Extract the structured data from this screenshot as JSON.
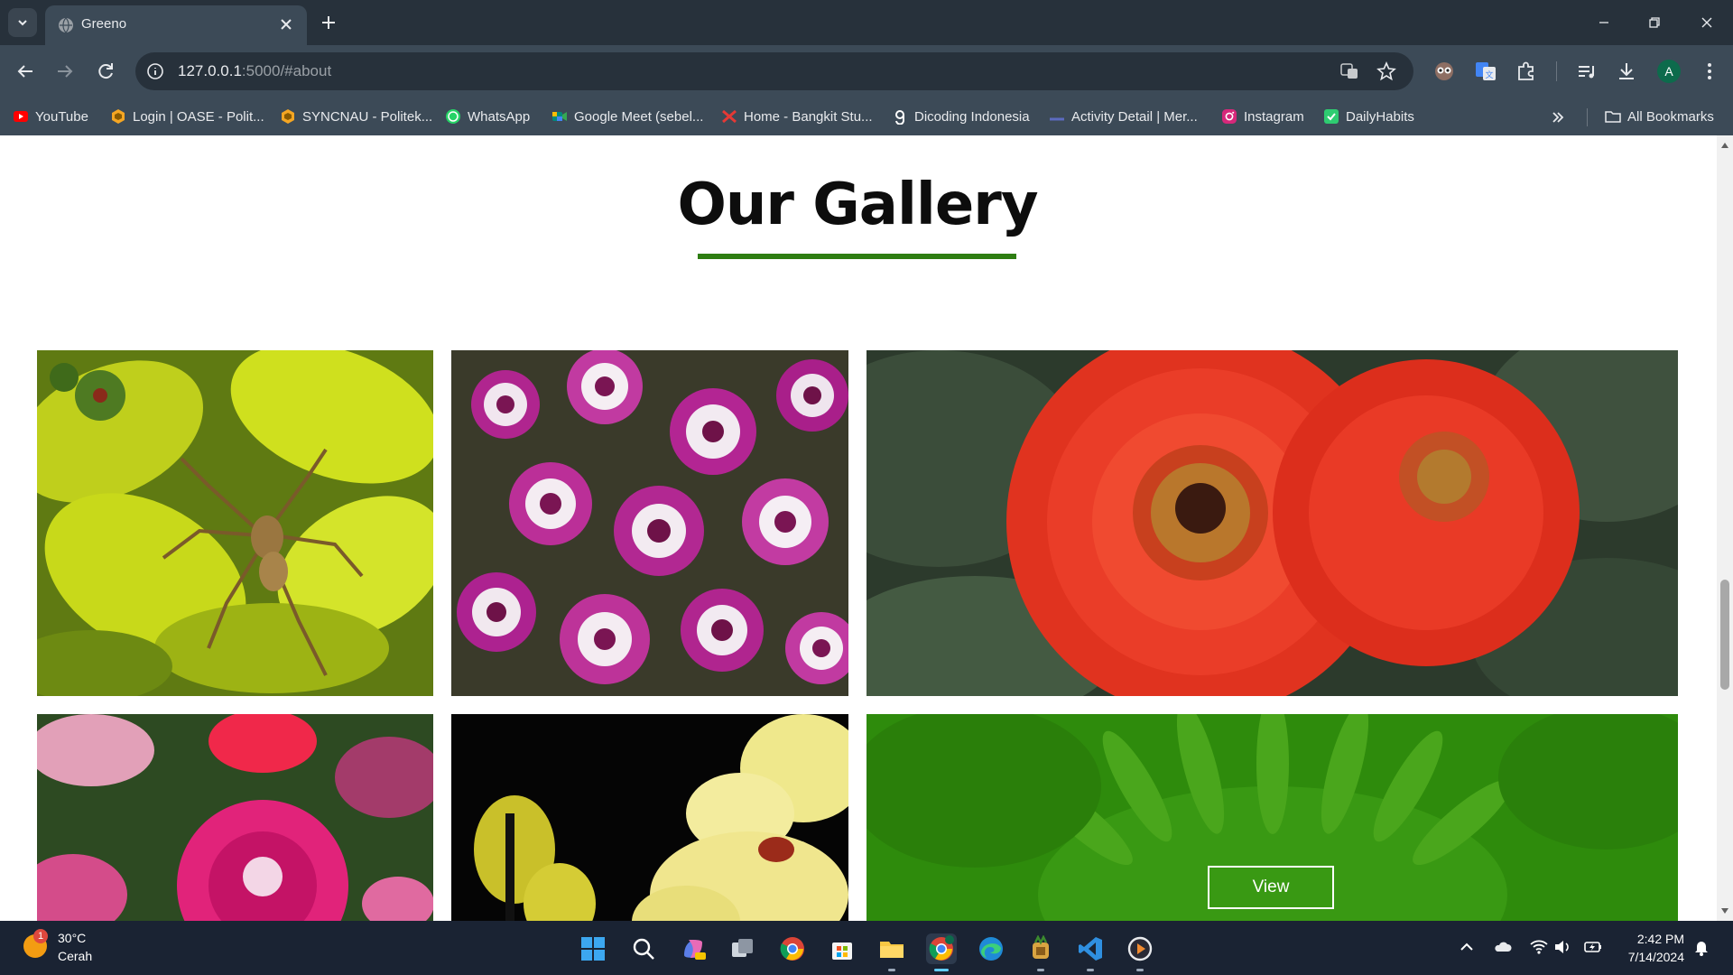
{
  "browser": {
    "tab_title": "Greeno",
    "url_host": "127.0.0.1",
    "url_rest": ":5000/#about",
    "bookmarks": [
      {
        "label": "YouTube",
        "icon": "youtube-icon",
        "color": "#ff0000"
      },
      {
        "label": "Login | OASE - Polit...",
        "icon": "oase-icon",
        "color": "#f5a623"
      },
      {
        "label": "SYNCNAU - Politek...",
        "icon": "syncnau-icon",
        "color": "#f5a623"
      },
      {
        "label": "WhatsApp",
        "icon": "whatsapp-icon",
        "color": "#25d366"
      },
      {
        "label": "Google Meet (sebel...",
        "icon": "google-meet-icon",
        "color": "#00897b"
      },
      {
        "label": "Home - Bangkit Stu...",
        "icon": "bangkit-icon",
        "color": "#e53935"
      },
      {
        "label": "Dicoding Indonesia",
        "icon": "dicoding-icon",
        "color": "#ffffff"
      },
      {
        "label": "Activity Detail | Mer...",
        "icon": "activity-icon",
        "color": "#3f51b5"
      },
      {
        "label": "Instagram",
        "icon": "instagram-icon",
        "color": "#e1306c"
      },
      {
        "label": "DailyHabits",
        "icon": "dailyhabits-icon",
        "color": "#2ecc71"
      }
    ],
    "all_bookmarks_label": "All Bookmarks",
    "profile_initial": "A"
  },
  "page": {
    "gallery_title": "Our Gallery",
    "accent_color": "#2e7d12",
    "images": [
      {
        "subject": "spider on yellow-green leaves"
      },
      {
        "subject": "purple and white cineraria flowers"
      },
      {
        "subject": "red gerbera daisies"
      },
      {
        "subject": "pink dianthus flowers"
      },
      {
        "subject": "yellow orchids"
      },
      {
        "subject": "flower with green overlay"
      }
    ],
    "view_button_label": "View"
  },
  "taskbar": {
    "temperature": "30°C",
    "weather_desc": "Cerah",
    "weather_badge": "1",
    "time": "2:42 PM",
    "date": "7/14/2024"
  }
}
